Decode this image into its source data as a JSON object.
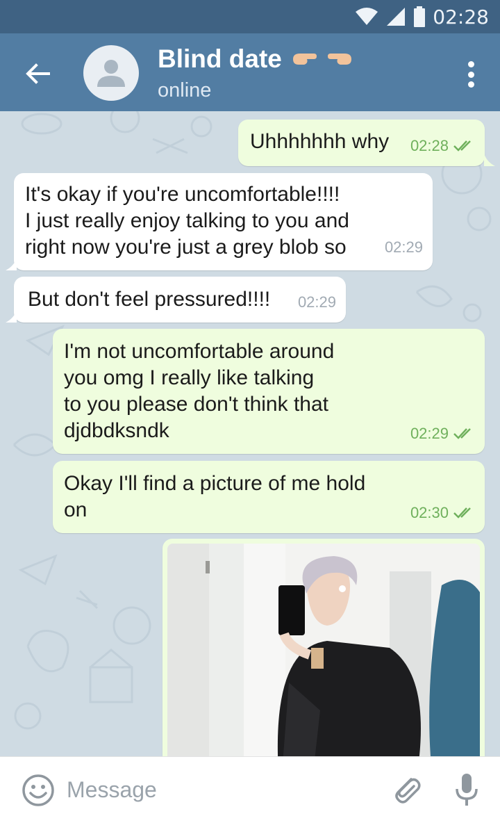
{
  "status_bar": {
    "time": "02:28"
  },
  "header": {
    "title": "Blind date",
    "title_emoji": "pointing-hands",
    "status": "online"
  },
  "messages": [
    {
      "direction": "out",
      "text": "Uhhhhhhh why",
      "time": "02:28",
      "read": true
    },
    {
      "direction": "in",
      "text": "It's okay if you're uncomfortable!!!!\nI just really enjoy talking to you and\nright now you're just a grey blob so",
      "time": "02:29"
    },
    {
      "direction": "in",
      "text": "But don't feel pressured!!!!",
      "time": "02:29"
    },
    {
      "direction": "out",
      "text": "I'm not uncomfortable around\nyou omg I really like talking\nto you please don't think that\ndjdbdksndk",
      "time": "02:29",
      "read": true
    },
    {
      "direction": "out",
      "text": "Okay I'll find a picture of me hold\non",
      "time": "02:30",
      "read": true
    },
    {
      "direction": "out",
      "type": "photo",
      "content": "mirror-selfie"
    }
  ],
  "input": {
    "placeholder": "Message"
  },
  "icons": {
    "back": "arrow-left-icon",
    "menu": "more-vertical-icon",
    "emoji": "smiley-icon",
    "attach": "paperclip-icon",
    "mic": "microphone-icon"
  },
  "colors": {
    "status_bar": "#3f6283",
    "toolbar": "#527da3",
    "chat_bg": "#cfdbe3",
    "outgoing_bubble": "#effdde",
    "incoming_bubble": "#ffffff",
    "outgoing_meta": "#6fb05c",
    "incoming_meta": "#a1aab3"
  }
}
